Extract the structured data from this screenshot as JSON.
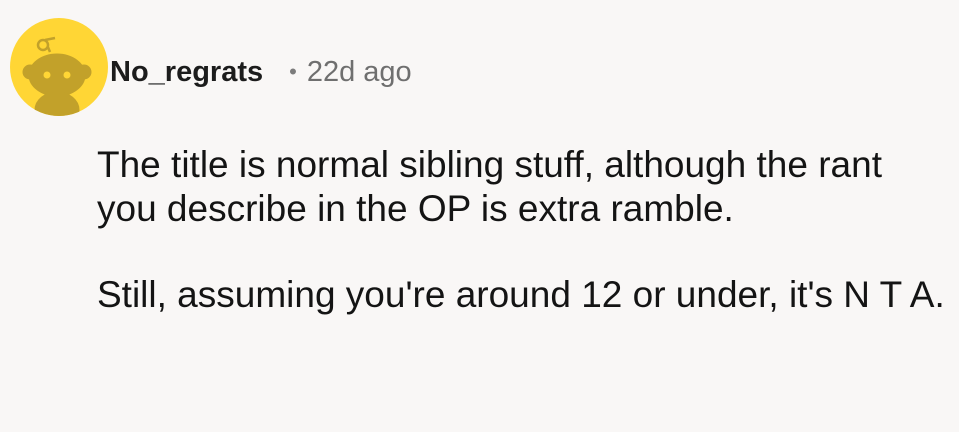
{
  "comment": {
    "author": "No_regrats",
    "separator": "•",
    "time_ago": "22d ago",
    "avatar_icon": "reddit-snoo-avatar-icon",
    "avatar_color": "#ffd635",
    "paragraphs": [
      "The title is normal sibling stuff, although the rant you describe in the OP is extra ramble.",
      "Still, assuming you're around 12 or under, it's N T A."
    ]
  }
}
